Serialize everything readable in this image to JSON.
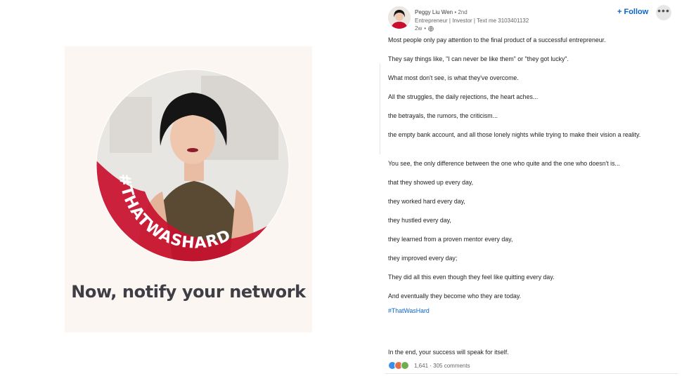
{
  "card": {
    "caption": "Now, notify your network",
    "badge_text": "#THATWASHARD"
  },
  "post": {
    "author": "Peggy Liu Wen",
    "degree": "2nd",
    "headline": "Entrepreneur | Investor | Text me 3103401132",
    "time": "2w",
    "follow_label": "+ Follow",
    "more_label": "•••",
    "lines": [
      "Most people only pay attention to the final product of a successful entrepreneur.",
      "They say things like, \"I can never be like them\" or \"they got lucky\".",
      "What most don't see, is what they've overcome.",
      "All the struggles, the daily rejections, the heart aches...",
      "the betrayals, the rumors, the criticism...",
      "the empty bank account, and all those lonely nights while trying to make their vision a reality.",
      "You see, the only difference between the one who quite and the one who doesn't is...",
      "that they showed up every day,",
      "they worked hard every day,",
      "they hustled every day,",
      "they learned from a proven mentor every day,",
      "they improved every day;",
      "They did all this even though they feel like quitting every day.",
      "And eventually they become who they are today."
    ],
    "hashtag": "#ThatWasHard",
    "closing": "In the end, your success will speak for itself.",
    "reactions": "1,641 · 305 comments"
  },
  "colors": {
    "accent": "#0a66c2",
    "badge_red": "#c8102e",
    "card_bg": "#fcf6f3"
  },
  "icons": [
    "globe-icon",
    "more-icon",
    "like-reaction-icon",
    "love-reaction-icon",
    "support-reaction-icon"
  ]
}
